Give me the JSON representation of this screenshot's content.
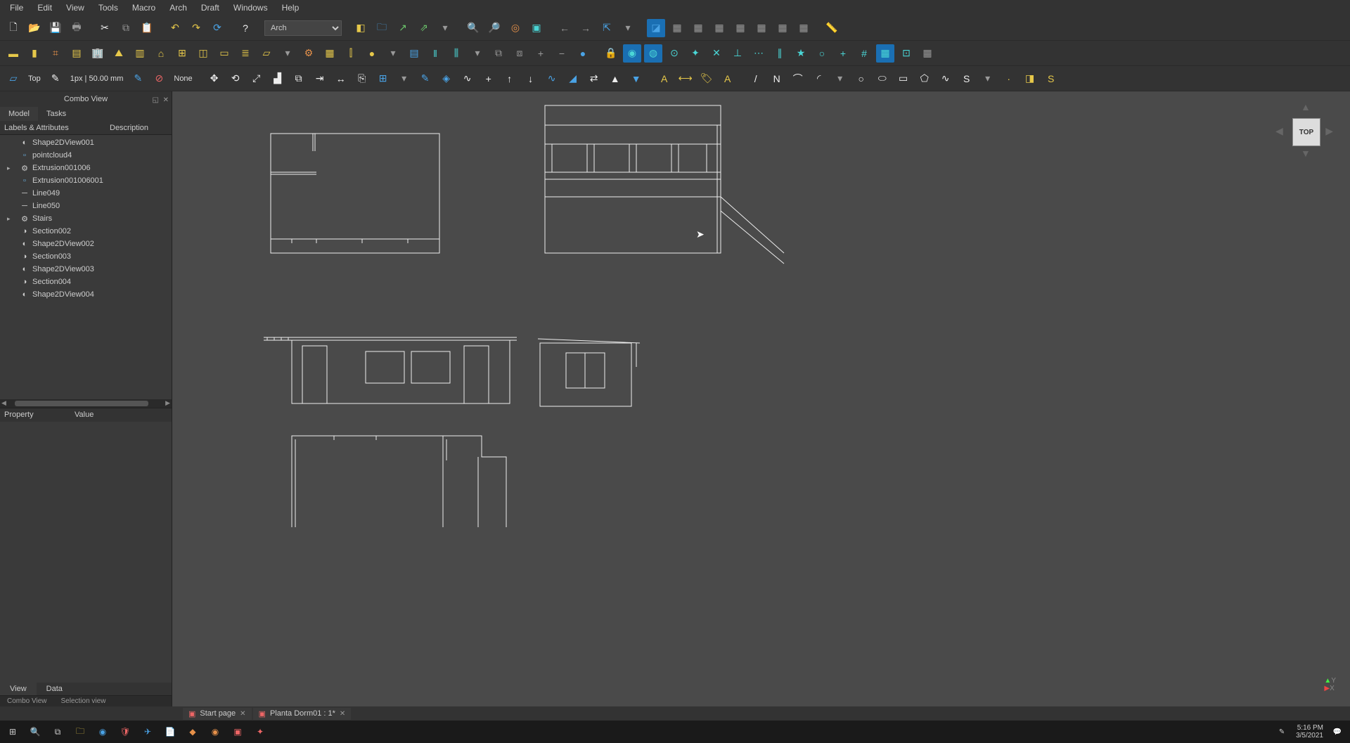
{
  "menus": [
    "File",
    "Edit",
    "View",
    "Tools",
    "Macro",
    "Arch",
    "Draft",
    "Windows",
    "Help"
  ],
  "workbench_selector": "Arch",
  "toolbar3": {
    "view_label": "Top",
    "px_label": "1px | 50.00 mm",
    "none_label": "None"
  },
  "combo": {
    "title": "Combo View",
    "tabs": [
      "Model",
      "Tasks"
    ],
    "tree_headers": [
      "Labels & Attributes",
      "Description"
    ],
    "items": [
      {
        "label": "Shape2DView001",
        "icon": "shape2d"
      },
      {
        "label": "pointcloud4",
        "icon": "box"
      },
      {
        "label": "Extrusion001006",
        "icon": "gear",
        "expandable": true
      },
      {
        "label": "Extrusion001006001",
        "icon": "box"
      },
      {
        "label": "Line049",
        "icon": "line"
      },
      {
        "label": "Line050",
        "icon": "line"
      },
      {
        "label": "Stairs",
        "icon": "gear",
        "expandable": true
      },
      {
        "label": "Section002",
        "icon": "section"
      },
      {
        "label": "Shape2DView002",
        "icon": "shape2d"
      },
      {
        "label": "Section003",
        "icon": "section"
      },
      {
        "label": "Shape2DView003",
        "icon": "shape2d"
      },
      {
        "label": "Section004",
        "icon": "section"
      },
      {
        "label": "Shape2DView004",
        "icon": "shape2d"
      }
    ],
    "prop_headers": [
      "Property",
      "Value"
    ],
    "bottom_tabs": [
      "View",
      "Data"
    ],
    "bottom_tabs2": [
      "Combo View",
      "Selection view"
    ]
  },
  "navcube_label": "TOP",
  "axis_labels": {
    "x": "X",
    "y": "Y"
  },
  "doc_tabs": [
    {
      "label": "Start page"
    },
    {
      "label": "Planta Dorm01 : 1*"
    }
  ],
  "taskbar": {
    "time": "5:16 PM",
    "date": "3/5/2021"
  },
  "icons": {
    "row1": [
      {
        "n": "new-icon",
        "g": "🗋",
        "c": "c-white"
      },
      {
        "n": "open-icon",
        "g": "📂",
        "c": "c-yellow"
      },
      {
        "n": "save-icon",
        "g": "💾",
        "c": "c-gray"
      },
      {
        "n": "print-icon",
        "g": "🖶",
        "c": "c-gray"
      },
      {
        "n": "sep"
      },
      {
        "n": "cut-icon",
        "g": "✂",
        "c": "c-white"
      },
      {
        "n": "copy-icon",
        "g": "⧉",
        "c": "c-gray"
      },
      {
        "n": "paste-icon",
        "g": "📋",
        "c": "c-gray"
      },
      {
        "n": "sep"
      },
      {
        "n": "undo-icon",
        "g": "↶",
        "c": "c-yellow"
      },
      {
        "n": "redo-icon",
        "g": "↷",
        "c": "c-yellow"
      },
      {
        "n": "refresh-icon",
        "g": "⟳",
        "c": "c-blue"
      },
      {
        "n": "sep"
      },
      {
        "n": "whatsthis-icon",
        "g": "?",
        "c": "c-white"
      },
      {
        "n": "sep"
      },
      {
        "n": "workbench-select"
      },
      {
        "n": "sep"
      },
      {
        "n": "part-icon",
        "g": "◧",
        "c": "c-yellow"
      },
      {
        "n": "group-icon",
        "g": "🗀",
        "c": "c-blue"
      },
      {
        "n": "link-icon",
        "g": "↗",
        "c": "c-green"
      },
      {
        "n": "linkgroup-icon",
        "g": "⇗",
        "c": "c-green"
      },
      {
        "n": "dropdown1-icon",
        "g": "▾",
        "c": "c-gray"
      },
      {
        "n": "sep"
      },
      {
        "n": "fit-icon",
        "g": "🔍",
        "c": "c-blue"
      },
      {
        "n": "fitsel-icon",
        "g": "🔎",
        "c": "c-blue"
      },
      {
        "n": "drawstyle-icon",
        "g": "◎",
        "c": "c-orange"
      },
      {
        "n": "boundbox-icon",
        "g": "▣",
        "c": "c-cyan"
      },
      {
        "n": "sep"
      },
      {
        "n": "nav-left-icon",
        "g": "←",
        "c": "c-gray"
      },
      {
        "n": "nav-right-icon",
        "g": "→",
        "c": "c-gray"
      },
      {
        "n": "nav-up-icon",
        "g": "⇱",
        "c": "c-blue"
      },
      {
        "n": "dropdown2-icon",
        "g": "▾",
        "c": "c-gray"
      },
      {
        "n": "sep"
      },
      {
        "n": "iso-icon",
        "g": "◪",
        "c": "c-blue",
        "active": true
      },
      {
        "n": "front-icon",
        "g": "▦",
        "c": "c-gray"
      },
      {
        "n": "top-icon",
        "g": "▦",
        "c": "c-gray"
      },
      {
        "n": "right-icon",
        "g": "▦",
        "c": "c-gray"
      },
      {
        "n": "rear-icon",
        "g": "▦",
        "c": "c-gray"
      },
      {
        "n": "bottom-icon",
        "g": "▦",
        "c": "c-gray"
      },
      {
        "n": "left-icon",
        "g": "▦",
        "c": "c-gray"
      },
      {
        "n": "axon-icon",
        "g": "▦",
        "c": "c-gray"
      },
      {
        "n": "sep"
      },
      {
        "n": "measure-icon",
        "g": "📏",
        "c": "c-cyan"
      }
    ],
    "row2": [
      {
        "n": "wall-icon",
        "g": "▬",
        "c": "c-yellow"
      },
      {
        "n": "structure-icon",
        "g": "▮",
        "c": "c-yellow"
      },
      {
        "n": "rebar-icon",
        "g": "⌗",
        "c": "c-orange"
      },
      {
        "n": "floor-icon",
        "g": "▤",
        "c": "c-yellow"
      },
      {
        "n": "building-icon",
        "g": "🏢",
        "c": "c-yellow"
      },
      {
        "n": "site-icon",
        "g": "⛰",
        "c": "c-yellow"
      },
      {
        "n": "window-icon",
        "g": "▥",
        "c": "c-yellow"
      },
      {
        "n": "roof-icon",
        "g": "⌂",
        "c": "c-yellow"
      },
      {
        "n": "axis-icon",
        "g": "⊞",
        "c": "c-yellow"
      },
      {
        "n": "sectionplane-icon",
        "g": "◫",
        "c": "c-yellow"
      },
      {
        "n": "space-icon",
        "g": "▭",
        "c": "c-yellow"
      },
      {
        "n": "stairs-icon",
        "g": "≣",
        "c": "c-yellow"
      },
      {
        "n": "panel-icon",
        "g": "▱",
        "c": "c-yellow"
      },
      {
        "n": "dropdown3-icon",
        "g": "▾",
        "c": "c-gray"
      },
      {
        "n": "equipment-icon",
        "g": "⚙",
        "c": "c-orange"
      },
      {
        "n": "frame-icon",
        "g": "▦",
        "c": "c-yellow"
      },
      {
        "n": "fence-icon",
        "g": "⫿",
        "c": "c-yellow"
      },
      {
        "n": "material-icon",
        "g": "●",
        "c": "c-yellow"
      },
      {
        "n": "dropdown4-icon",
        "g": "▾",
        "c": "c-gray"
      },
      {
        "n": "schedule-icon",
        "g": "▤",
        "c": "c-blue"
      },
      {
        "n": "pipe-icon",
        "g": "‖",
        "c": "c-cyan"
      },
      {
        "n": "pipeconn-icon",
        "g": "⫼",
        "c": "c-cyan"
      },
      {
        "n": "dropdown5-icon",
        "g": "▾",
        "c": "c-gray"
      },
      {
        "n": "cutplane-icon",
        "g": "⧉",
        "c": "c-gray"
      },
      {
        "n": "cutline-icon",
        "g": "⧈",
        "c": "c-gray"
      },
      {
        "n": "addcomp-icon",
        "g": "+",
        "c": "c-gray"
      },
      {
        "n": "remcomp-icon",
        "g": "−",
        "c": "c-gray"
      },
      {
        "n": "survey-icon",
        "g": "●",
        "c": "c-blue"
      },
      {
        "n": "sep"
      },
      {
        "n": "lock-icon",
        "g": "🔒",
        "c": "c-cyan"
      },
      {
        "n": "snap-endpoint-icon",
        "g": "◉",
        "c": "c-cyan",
        "active": true
      },
      {
        "n": "snap-midpoint-icon",
        "g": "◍",
        "c": "c-cyan",
        "active": true
      },
      {
        "n": "snap-center-icon",
        "g": "⊙",
        "c": "c-cyan"
      },
      {
        "n": "snap-angle-icon",
        "g": "✦",
        "c": "c-cyan"
      },
      {
        "n": "snap-intersect-icon",
        "g": "✕",
        "c": "c-cyan"
      },
      {
        "n": "snap-perp-icon",
        "g": "⊥",
        "c": "c-cyan"
      },
      {
        "n": "snap-ext-icon",
        "g": "⋯",
        "c": "c-cyan"
      },
      {
        "n": "snap-parallel-icon",
        "g": "∥",
        "c": "c-cyan"
      },
      {
        "n": "snap-special-icon",
        "g": "★",
        "c": "c-cyan"
      },
      {
        "n": "snap-near-icon",
        "g": "○",
        "c": "c-cyan"
      },
      {
        "n": "snap-ortho-icon",
        "g": "+",
        "c": "c-cyan"
      },
      {
        "n": "snap-grid-icon",
        "g": "#",
        "c": "c-cyan"
      },
      {
        "n": "snap-wp-icon",
        "g": "▦",
        "c": "c-cyan",
        "active": true
      },
      {
        "n": "snap-dim-icon",
        "g": "⊡",
        "c": "c-cyan"
      },
      {
        "n": "togglegrid-icon",
        "g": "▦",
        "c": "c-gray"
      }
    ],
    "row3": [
      {
        "n": "workplane-icon",
        "g": "▱",
        "c": "c-blue"
      },
      {
        "n": "wp-label"
      },
      {
        "n": "linewidth-icon",
        "g": "✎",
        "c": "c-white"
      },
      {
        "n": "px-label"
      },
      {
        "n": "construct-icon",
        "g": "✎",
        "c": "c-blue"
      },
      {
        "n": "autogroup-icon",
        "g": "⊘",
        "c": "c-red"
      },
      {
        "n": "none-label"
      },
      {
        "n": "sep"
      },
      {
        "n": "move-icon",
        "g": "✥",
        "c": "c-white"
      },
      {
        "n": "rotate-icon",
        "g": "⟲",
        "c": "c-white"
      },
      {
        "n": "scale-icon",
        "g": "⤢",
        "c": "c-white"
      },
      {
        "n": "mirror-icon",
        "g": "▟",
        "c": "c-white"
      },
      {
        "n": "offset-icon",
        "g": "⧉",
        "c": "c-white"
      },
      {
        "n": "trimex-icon",
        "g": "⇥",
        "c": "c-white"
      },
      {
        "n": "stretch-icon",
        "g": "↔",
        "c": "c-white"
      },
      {
        "n": "clone-icon",
        "g": "⎘",
        "c": "c-white"
      },
      {
        "n": "array-icon",
        "g": "⊞",
        "c": "c-blue"
      },
      {
        "n": "dropdown6-icon",
        "g": "▾",
        "c": "c-gray"
      },
      {
        "n": "edit-icon",
        "g": "✎",
        "c": "c-blue"
      },
      {
        "n": "subhighlight-icon",
        "g": "◈",
        "c": "c-blue"
      },
      {
        "n": "wire2bspline-icon",
        "g": "∿",
        "c": "c-white"
      },
      {
        "n": "addpoint-icon",
        "g": "+",
        "c": "c-white"
      },
      {
        "n": "delpoint-icon",
        "g": "↑",
        "c": "c-white"
      },
      {
        "n": "shape2d-icon",
        "g": "↓",
        "c": "c-white"
      },
      {
        "n": "draft2sketch-icon",
        "g": "∿",
        "c": "c-blue"
      },
      {
        "n": "slope-icon",
        "g": "◢",
        "c": "c-blue"
      },
      {
        "n": "flipdim-icon",
        "g": "⇄",
        "c": "c-white"
      },
      {
        "n": "upgrade-icon",
        "g": "▲",
        "c": "c-white"
      },
      {
        "n": "downgrade-icon",
        "g": "▼",
        "c": "c-blue"
      },
      {
        "n": "sep"
      },
      {
        "n": "text-icon",
        "g": "A",
        "c": "c-yellow"
      },
      {
        "n": "dimension-icon",
        "g": "⟷",
        "c": "c-yellow"
      },
      {
        "n": "label-icon",
        "g": "🏷",
        "c": "c-yellow"
      },
      {
        "n": "annot-icon",
        "g": "A",
        "c": "c-yellow"
      },
      {
        "n": "sep"
      },
      {
        "n": "line-icon",
        "g": "/",
        "c": "c-white"
      },
      {
        "n": "wire-icon",
        "g": "N",
        "c": "c-white"
      },
      {
        "n": "fillet-icon",
        "g": "⌒",
        "c": "c-white"
      },
      {
        "n": "arc-icon",
        "g": "◜",
        "c": "c-white"
      },
      {
        "n": "dropdown7-icon",
        "g": "▾",
        "c": "c-gray"
      },
      {
        "n": "circle-icon",
        "g": "○",
        "c": "c-white"
      },
      {
        "n": "ellipse-icon",
        "g": "⬭",
        "c": "c-white"
      },
      {
        "n": "rect-icon",
        "g": "▭",
        "c": "c-white"
      },
      {
        "n": "polygon-icon",
        "g": "⬠",
        "c": "c-white"
      },
      {
        "n": "bspline-icon",
        "g": "∿",
        "c": "c-white"
      },
      {
        "n": "bezier-icon",
        "g": "S",
        "c": "c-white"
      },
      {
        "n": "dropdown8-icon",
        "g": "▾",
        "c": "c-gray"
      },
      {
        "n": "point-icon",
        "g": "·",
        "c": "c-yellow"
      },
      {
        "n": "facebinder-icon",
        "g": "◨",
        "c": "c-yellow"
      },
      {
        "n": "shapestring-icon",
        "g": "S",
        "c": "c-yellow"
      }
    ]
  }
}
